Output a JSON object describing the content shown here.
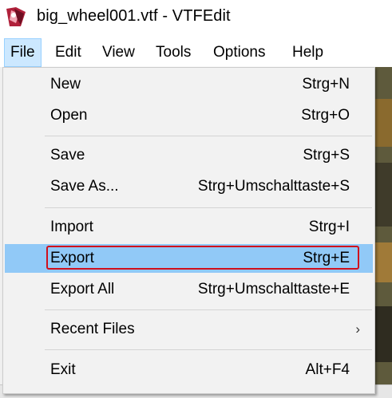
{
  "window": {
    "title": "big_wheel001.vtf - VTFEdit",
    "icon": "vtfedit-app-icon"
  },
  "menubar": {
    "items": [
      {
        "label": "File",
        "active": true
      },
      {
        "label": "Edit"
      },
      {
        "label": "View"
      },
      {
        "label": "Tools"
      },
      {
        "label": "Options"
      },
      {
        "label": "Help"
      }
    ]
  },
  "file_menu": {
    "items": [
      {
        "label": "New",
        "shortcut": "Strg+N"
      },
      {
        "label": "Open",
        "shortcut": "Strg+O"
      },
      {
        "label": "Save",
        "shortcut": "Strg+S"
      },
      {
        "label": "Save As...",
        "shortcut": "Strg+Umschalttaste+S"
      },
      {
        "label": "Import",
        "shortcut": "Strg+I"
      },
      {
        "label": "Export",
        "shortcut": "Strg+E",
        "highlighted": true
      },
      {
        "label": "Export All",
        "shortcut": "Strg+Umschalttaste+E"
      },
      {
        "label": "Recent Files",
        "submenu_icon": "chevron-right-icon"
      },
      {
        "label": "Exit",
        "shortcut": "Alt+F4"
      }
    ]
  },
  "colors": {
    "highlight": "#91c9f7",
    "focus_outline": "#d0101d",
    "menubar_active": "#cce8ff",
    "menu_background": "#f2f2f2"
  }
}
